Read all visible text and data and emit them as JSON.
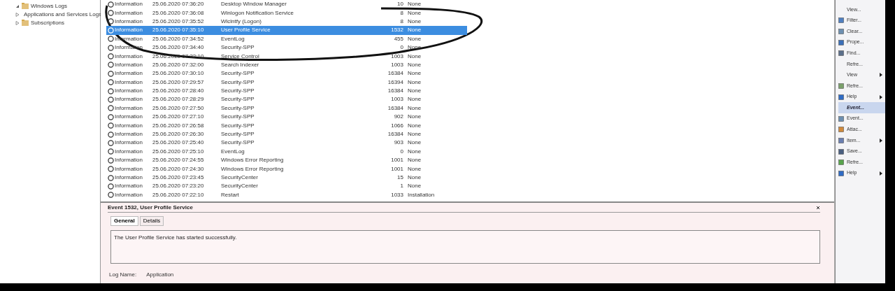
{
  "tree": {
    "items": [
      {
        "label": "Windows Logs",
        "expanded": true
      },
      {
        "label": "Applications and Services Logs",
        "expanded": false
      },
      {
        "label": "Subscriptions",
        "expanded": false
      }
    ]
  },
  "events": {
    "rows": [
      {
        "level": "Information",
        "date": "25.06.2020 07:36:20",
        "source": "Desktop Window Manager",
        "id": "10",
        "category": "None",
        "selected": false
      },
      {
        "level": "Information",
        "date": "25.06.2020 07:36:08",
        "source": "Winlogon Notification Service",
        "id": "8",
        "category": "None",
        "selected": false
      },
      {
        "level": "Information",
        "date": "25.06.2020 07:35:52",
        "source": "Wlclntfy (Logon)",
        "id": "8",
        "category": "None",
        "selected": false
      },
      {
        "level": "Information",
        "date": "25.06.2020 07:35:10",
        "source": "User Profile Service",
        "id": "1532",
        "category": "None",
        "selected": true
      },
      {
        "level": "Information",
        "date": "25.06.2020 07:34:52",
        "source": "EventLog",
        "id": "455",
        "category": "None",
        "selected": false
      },
      {
        "level": "Information",
        "date": "25.06.2020 07:34:40",
        "source": "Security-SPP",
        "id": "0",
        "category": "None",
        "selected": false
      },
      {
        "level": "Information",
        "date": "25.06.2020 07:32:10",
        "source": "Service Control",
        "id": "1003",
        "category": "None",
        "selected": false
      },
      {
        "level": "Information",
        "date": "25.06.2020 07:32:00",
        "source": "Search Indexer",
        "id": "1003",
        "category": "None",
        "selected": false
      },
      {
        "level": "Information",
        "date": "25.06.2020 07:30:10",
        "source": "Security-SPP",
        "id": "16384",
        "category": "None",
        "selected": false
      },
      {
        "level": "Information",
        "date": "25.06.2020 07:29:57",
        "source": "Security-SPP",
        "id": "16394",
        "category": "None",
        "selected": false
      },
      {
        "level": "Information",
        "date": "25.06.2020 07:28:40",
        "source": "Security-SPP",
        "id": "16384",
        "category": "None",
        "selected": false
      },
      {
        "level": "Information",
        "date": "25.06.2020 07:28:29",
        "source": "Security-SPP",
        "id": "1003",
        "category": "None",
        "selected": false
      },
      {
        "level": "Information",
        "date": "25.06.2020 07:27:50",
        "source": "Security-SPP",
        "id": "16384",
        "category": "None",
        "selected": false
      },
      {
        "level": "Information",
        "date": "25.06.2020 07:27:10",
        "source": "Security-SPP",
        "id": "902",
        "category": "None",
        "selected": false
      },
      {
        "level": "Information",
        "date": "25.06.2020 07:26:58",
        "source": "Security-SPP",
        "id": "1066",
        "category": "None",
        "selected": false
      },
      {
        "level": "Information",
        "date": "25.06.2020 07:26:30",
        "source": "Security-SPP",
        "id": "16384",
        "category": "None",
        "selected": false
      },
      {
        "level": "Information",
        "date": "25.06.2020 07:25:40",
        "source": "Security-SPP",
        "id": "903",
        "category": "None",
        "selected": false
      },
      {
        "level": "Information",
        "date": "25.06.2020 07:25:10",
        "source": "EventLog",
        "id": "0",
        "category": "None",
        "selected": false
      },
      {
        "level": "Information",
        "date": "25.06.2020 07:24:55",
        "source": "Windows Error Reporting",
        "id": "1001",
        "category": "None",
        "selected": false
      },
      {
        "level": "Information",
        "date": "25.06.2020 07:24:30",
        "source": "Windows Error Reporting",
        "id": "1001",
        "category": "None",
        "selected": false
      },
      {
        "level": "Information",
        "date": "25.06.2020 07:23:45",
        "source": "SecurityCenter",
        "id": "15",
        "category": "None",
        "selected": false
      },
      {
        "level": "Information",
        "date": "25.06.2020 07:23:20",
        "source": "SecurityCenter",
        "id": "1",
        "category": "None",
        "selected": false
      },
      {
        "level": "Information",
        "date": "25.06.2020 07:22:10",
        "source": "Restart",
        "id": "1033",
        "category": "Installation",
        "selected": false
      }
    ]
  },
  "details": {
    "title": "Event 1532, User Profile Service",
    "tabs": [
      {
        "label": "General",
        "selected": true
      },
      {
        "label": "Details",
        "selected": false
      }
    ],
    "message": "The User Profile Service has started successfully.",
    "fields": [
      "Log Name:",
      "Application"
    ]
  },
  "actions": {
    "items": [
      {
        "label": "View...",
        "kind": "plain",
        "submenu": false,
        "selected": false
      },
      {
        "label": "Filter...",
        "kind": "icon",
        "submenu": false,
        "selected": false
      },
      {
        "label": "Clear...",
        "kind": "icon",
        "submenu": false,
        "selected": false
      },
      {
        "label": "Prope...",
        "kind": "icon",
        "submenu": false,
        "selected": false
      },
      {
        "label": "Find...",
        "kind": "icon",
        "submenu": false,
        "selected": false
      },
      {
        "label": "Refre...",
        "kind": "plain",
        "submenu": false,
        "selected": false
      },
      {
        "label": "View",
        "kind": "plain",
        "submenu": true,
        "selected": false
      },
      {
        "label": "Refre...",
        "kind": "icon",
        "submenu": false,
        "selected": false
      },
      {
        "label": "Help",
        "kind": "icon",
        "submenu": true,
        "selected": false
      },
      {
        "label": "Event...",
        "kind": "header",
        "submenu": false,
        "selected": true
      },
      {
        "label": "Event...",
        "kind": "icon",
        "submenu": false,
        "selected": false
      },
      {
        "label": "Attac...",
        "kind": "icon",
        "submenu": false,
        "selected": false
      },
      {
        "label": "Item...",
        "kind": "icon",
        "submenu": true,
        "selected": false
      },
      {
        "label": "Save...",
        "kind": "icon",
        "submenu": false,
        "selected": false
      },
      {
        "label": "Refre...",
        "kind": "icon",
        "submenu": false,
        "selected": false
      },
      {
        "label": "Help",
        "kind": "icon",
        "submenu": true,
        "selected": false
      }
    ]
  }
}
